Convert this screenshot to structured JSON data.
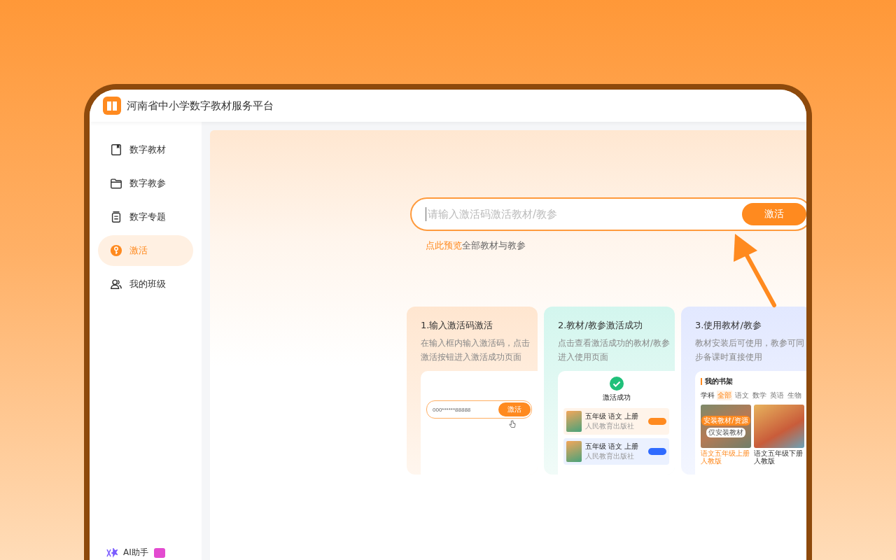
{
  "app": {
    "title": "河南省中小学数字教材服务平台"
  },
  "sidebar": {
    "items": [
      {
        "label": "数字教材",
        "selected": false
      },
      {
        "label": "数字教参",
        "selected": false
      },
      {
        "label": "数字专题",
        "selected": false
      },
      {
        "label": "激活",
        "selected": true
      },
      {
        "label": "我的班级",
        "selected": false
      }
    ],
    "footer": {
      "label": "AI助手"
    }
  },
  "activation": {
    "placeholder": "请输入激活码激活教材/教参",
    "button": "激活",
    "hint_link": "点此预览",
    "hint_text": "全部教材与教参"
  },
  "steps": [
    {
      "kind": "code",
      "title": "1.输入激活码激活",
      "description": "在输入框内输入激活码，点击激活按钮进入激活成功页面",
      "demo": {
        "code": "000******88888",
        "button": "激活"
      }
    },
    {
      "kind": "success",
      "title": "2.教材/教参激活成功",
      "description": "点击查看激活成功的教材/教参进入使用页面",
      "demo": {
        "title": "激活成功",
        "books": [
          {
            "title": "五年级 语文 上册",
            "publisher": "人民教育出版社",
            "color": "#ff8a1f"
          },
          {
            "title": "五年级 语文 上册",
            "publisher": "人民教育出版社",
            "color": "#2f6bff"
          }
        ]
      }
    },
    {
      "kind": "shelf",
      "title": "3.使用教材/教参",
      "description": "教材安装后可使用，教参可同步备课时直接使用",
      "demo": {
        "title": "我的书架",
        "subject_label": "学科",
        "tabs": [
          {
            "label": "全部",
            "selected": true
          },
          {
            "label": "语文",
            "selected": false
          },
          {
            "label": "数学",
            "selected": false
          },
          {
            "label": "英语",
            "selected": false
          },
          {
            "label": "生物",
            "selected": false
          }
        ],
        "books": [
          {
            "caption": "语文五年级上册人教版",
            "selected": true,
            "actions": [
              "安装教材/资源",
              "仅安装教材"
            ]
          },
          {
            "caption": "语文五年级下册人教版",
            "selected": false
          }
        ]
      }
    }
  ]
}
